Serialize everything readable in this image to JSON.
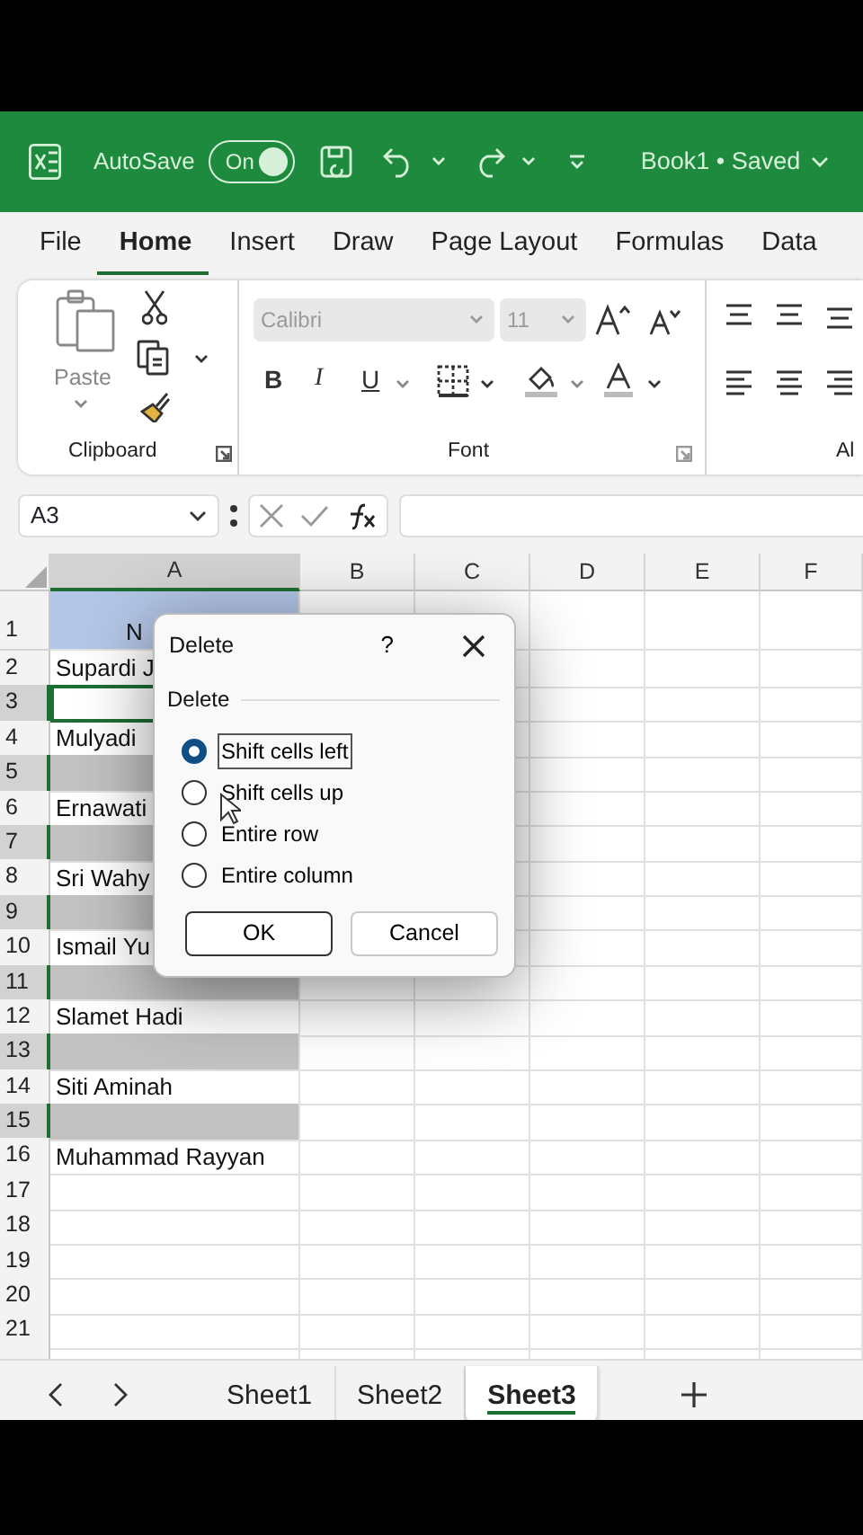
{
  "title_bar": {
    "autosave_label": "AutoSave",
    "autosave": {
      "label": "On",
      "on": true
    },
    "document_title": "Book1 • Saved"
  },
  "menu_tabs": [
    {
      "label": "File",
      "selected": false
    },
    {
      "label": "Home",
      "selected": true
    },
    {
      "label": "Insert",
      "selected": false
    },
    {
      "label": "Draw",
      "selected": false
    },
    {
      "label": "Page Layout",
      "selected": false
    },
    {
      "label": "Formulas",
      "selected": false
    },
    {
      "label": "Data",
      "selected": false
    }
  ],
  "ribbon": {
    "groups": [
      {
        "kind": "clipboard",
        "label": "Clipboard",
        "paste_label": "Paste"
      },
      {
        "kind": "font",
        "label": "Font",
        "font_name": "Calibri",
        "font_size": "11",
        "bold": "B",
        "italic": "I",
        "underline": "U"
      },
      {
        "kind": "alignment",
        "label": "Al"
      }
    ]
  },
  "formula_bar": {
    "name_box": "A3"
  },
  "grid": {
    "columns": [
      {
        "label": "A",
        "selected": true
      },
      {
        "label": "B",
        "selected": false
      },
      {
        "label": "C",
        "selected": false
      },
      {
        "label": "D",
        "selected": false
      },
      {
        "label": "E",
        "selected": false
      },
      {
        "label": "F",
        "selected": false
      }
    ],
    "rows": [
      {
        "number": "1",
        "selected": false,
        "active": false,
        "kind": "header",
        "cell": "N"
      },
      {
        "number": "2",
        "selected": false,
        "active": false,
        "kind": "data",
        "cell": "Supardi J"
      },
      {
        "number": "3",
        "selected": true,
        "active": true,
        "kind": "data"
      },
      {
        "number": "4",
        "selected": false,
        "active": false,
        "kind": "data",
        "cell": "Mulyadi"
      },
      {
        "number": "5",
        "selected": true,
        "active": false,
        "kind": "data"
      },
      {
        "number": "6",
        "selected": false,
        "active": false,
        "kind": "data",
        "cell": "Ernawati"
      },
      {
        "number": "7",
        "selected": true,
        "active": false,
        "kind": "data"
      },
      {
        "number": "8",
        "selected": false,
        "active": false,
        "kind": "data",
        "cell": "Sri Wahy"
      },
      {
        "number": "9",
        "selected": true,
        "active": false,
        "kind": "data"
      },
      {
        "number": "10",
        "selected": false,
        "active": false,
        "kind": "data",
        "cell": "Ismail Yu"
      },
      {
        "number": "11",
        "selected": true,
        "active": false,
        "kind": "data"
      },
      {
        "number": "12",
        "selected": false,
        "active": false,
        "kind": "data",
        "cell": "Slamet Hadi"
      },
      {
        "number": "13",
        "selected": true,
        "active": false,
        "kind": "data"
      },
      {
        "number": "14",
        "selected": false,
        "active": false,
        "kind": "data",
        "cell": "Siti Aminah"
      },
      {
        "number": "15",
        "selected": true,
        "active": false,
        "kind": "data"
      },
      {
        "number": "16",
        "selected": false,
        "active": false,
        "kind": "data",
        "cell": "Muhammad Rayyan"
      },
      {
        "number": "17",
        "selected": false,
        "active": false,
        "kind": "data"
      },
      {
        "number": "18",
        "selected": false,
        "active": false,
        "kind": "data"
      },
      {
        "number": "19",
        "selected": false,
        "active": false,
        "kind": "data"
      },
      {
        "number": "20",
        "selected": false,
        "active": false,
        "kind": "data"
      },
      {
        "number": "21",
        "selected": false,
        "active": false,
        "kind": "data"
      }
    ]
  },
  "dialog": {
    "title": "Delete",
    "help": "?",
    "group_label": "Delete",
    "options": [
      {
        "label": "Shift cells left",
        "selected": true
      },
      {
        "label": "Shift cells up",
        "selected": false
      },
      {
        "label": "Entire row",
        "selected": false
      },
      {
        "label": "Entire column",
        "selected": false
      }
    ],
    "buttons": [
      {
        "label": "OK",
        "kind": "default"
      },
      {
        "label": "Cancel",
        "kind": "normal"
      }
    ]
  },
  "sheet_tabs": [
    {
      "label": "Sheet1",
      "selected": false
    },
    {
      "label": "Sheet2",
      "selected": false
    },
    {
      "label": "Sheet3",
      "selected": true
    }
  ]
}
